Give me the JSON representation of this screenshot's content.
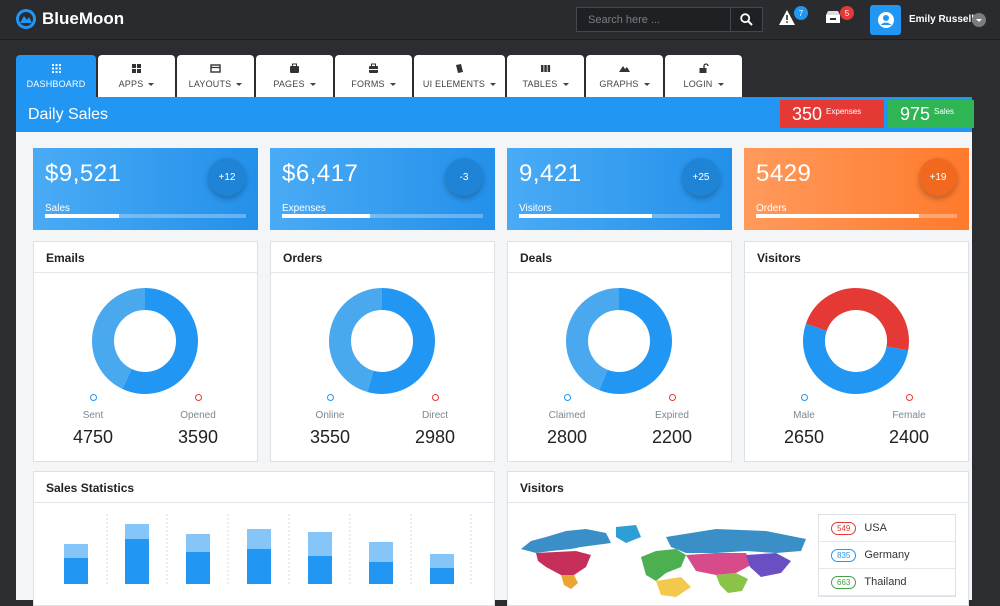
{
  "app": {
    "name": "BlueMoon"
  },
  "search": {
    "placeholder": "Search here ..."
  },
  "notifications": {
    "alerts": "7",
    "inbox": "5"
  },
  "user": {
    "name": "Emily Russell"
  },
  "tabs": [
    {
      "label": "DASHBOARD",
      "icon": "grid-icon"
    },
    {
      "label": "APPS",
      "icon": "apps-icon"
    },
    {
      "label": "LAYOUTS",
      "icon": "layout-icon"
    },
    {
      "label": "PAGES",
      "icon": "briefcase-icon"
    },
    {
      "label": "FORMS",
      "icon": "form-icon"
    },
    {
      "label": "UI ELEMENTS",
      "icon": "layers-icon"
    },
    {
      "label": "TABLES",
      "icon": "columns-icon"
    },
    {
      "label": "GRAPHS",
      "icon": "mountain-icon"
    },
    {
      "label": "LOGIN",
      "icon": "unlock-icon"
    }
  ],
  "header": {
    "title": "Daily Sales",
    "expenses_value": "350",
    "expenses_label": "Expenses",
    "sales_value": "975",
    "sales_label": "Sales"
  },
  "stats": [
    {
      "value": "$9,521",
      "label": "Sales",
      "change": "+12",
      "progress": 0.37
    },
    {
      "value": "$6,417",
      "label": "Expenses",
      "change": "-3",
      "progress": 0.44
    },
    {
      "value": "9,421",
      "label": "Visitors",
      "change": "+25",
      "progress": 0.66
    },
    {
      "value": "5429",
      "label": "Orders",
      "change": "+19",
      "progress": 0.81
    }
  ],
  "donuts": [
    {
      "title": "Emails",
      "a_label": "Sent",
      "a_value": "4750",
      "b_label": "Opened",
      "b_value": "3590"
    },
    {
      "title": "Orders",
      "a_label": "Online",
      "a_value": "3550",
      "b_label": "Direct",
      "b_value": "2980"
    },
    {
      "title": "Deals",
      "a_label": "Claimed",
      "a_value": "2800",
      "b_label": "Expired",
      "b_value": "2200"
    },
    {
      "title": "Visitors",
      "a_label": "Male",
      "a_value": "2650",
      "b_label": "Female",
      "b_value": "2400"
    }
  ],
  "sales_statistics": {
    "title": "Sales Statistics"
  },
  "visitors_map": {
    "title": "Visitors",
    "countries": [
      {
        "count": "549",
        "name": "USA",
        "color": "#e53935"
      },
      {
        "count": "835",
        "name": "Germany",
        "color": "#2196f3"
      },
      {
        "count": "663",
        "name": "Thailand",
        "color": "#43a047"
      }
    ]
  },
  "colors": {
    "primary": "#2196f3",
    "orange": "#ff7b2e",
    "red": "#e53935",
    "green": "#2fb553",
    "dark": "#2a2b2e"
  }
}
